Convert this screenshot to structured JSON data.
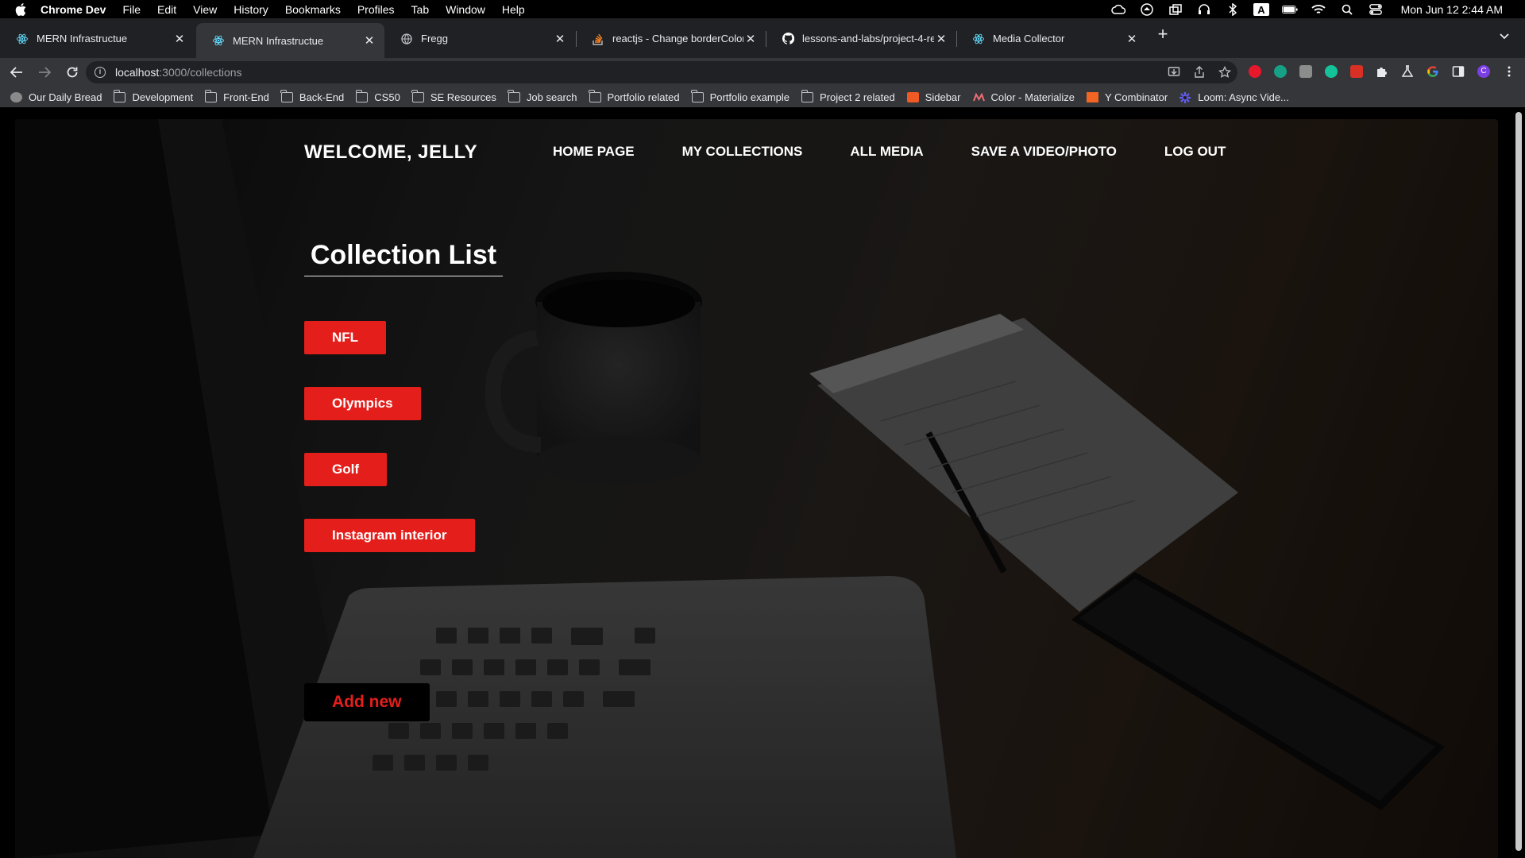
{
  "os_menubar": {
    "app_name": "Chrome Dev",
    "menus": [
      "File",
      "Edit",
      "View",
      "History",
      "Bookmarks",
      "Profiles",
      "Tab",
      "Window",
      "Help"
    ],
    "clock": "Mon Jun 12  2:44 AM"
  },
  "browser": {
    "tabs": [
      {
        "title": "MERN Infrastructue",
        "icon": "react-icon",
        "active": false
      },
      {
        "title": "MERN Infrastructue",
        "icon": "react-icon",
        "active": true
      },
      {
        "title": "Fregg",
        "icon": "globe-icon",
        "active": false
      },
      {
        "title": "reactjs - Change borderColor in",
        "icon": "stackoverflow-icon",
        "active": false
      },
      {
        "title": "lessons-and-labs/project-4-re",
        "icon": "github-icon",
        "active": false
      },
      {
        "title": "Media Collector",
        "icon": "react-icon",
        "active": false
      }
    ],
    "url_host": "localhost",
    "url_path": ":3000/collections",
    "bookmarks": [
      {
        "label": "Our Daily Bread",
        "icon": "globe-icon"
      },
      {
        "label": "Development",
        "icon": "folder-icon"
      },
      {
        "label": "Front-End",
        "icon": "folder-icon"
      },
      {
        "label": "Back-End",
        "icon": "folder-icon"
      },
      {
        "label": "CS50",
        "icon": "folder-icon"
      },
      {
        "label": "SE Resources",
        "icon": "folder-icon"
      },
      {
        "label": "Job search",
        "icon": "folder-icon"
      },
      {
        "label": "Portfolio related",
        "icon": "folder-icon"
      },
      {
        "label": "Portfolio example",
        "icon": "folder-icon"
      },
      {
        "label": "Project 2 related",
        "icon": "folder-icon"
      },
      {
        "label": "Sidebar",
        "icon": "sidebar-s-icon"
      },
      {
        "label": "Color - Materialize",
        "icon": "materialize-icon"
      },
      {
        "label": "Y Combinator",
        "icon": "ycombinator-icon"
      },
      {
        "label": "Loom: Async Vide...",
        "icon": "loom-icon"
      }
    ]
  },
  "app": {
    "welcome": "WELCOME, JELLY",
    "nav": [
      "HOME PAGE",
      "MY COLLECTIONS",
      "ALL MEDIA",
      "SAVE A VIDEO/PHOTO",
      "LOG OUT"
    ],
    "heading": "Collection List",
    "collections": [
      "NFL",
      "Olympics",
      "Golf",
      "Instagram interior"
    ],
    "add_new": "Add new",
    "colors": {
      "accent": "#e41f1b",
      "text": "#ffffff"
    }
  }
}
